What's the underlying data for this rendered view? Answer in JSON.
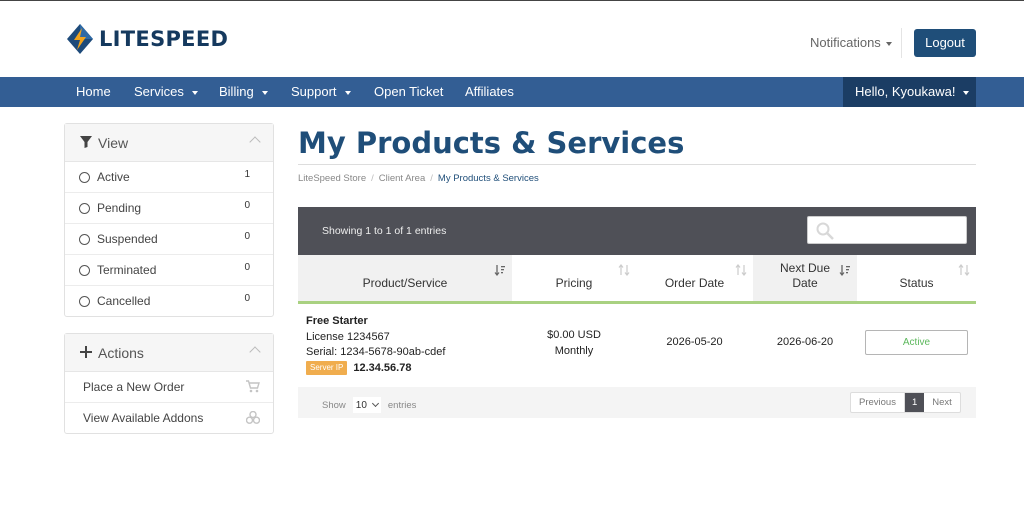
{
  "brand": {
    "name": "LITESPEED"
  },
  "header": {
    "notifications_label": "Notifications",
    "logout_label": "Logout"
  },
  "nav": {
    "items": [
      {
        "label": "Home",
        "has_caret": false
      },
      {
        "label": "Services",
        "has_caret": true
      },
      {
        "label": "Billing",
        "has_caret": true
      },
      {
        "label": "Support",
        "has_caret": true
      },
      {
        "label": "Open Ticket",
        "has_caret": false
      },
      {
        "label": "Affiliates",
        "has_caret": false
      }
    ],
    "user_label": "Hello, Kyoukawa!"
  },
  "sidebar": {
    "view": {
      "title": "View",
      "icon": "filter-icon",
      "filters": [
        {
          "label": "Active",
          "count": "1"
        },
        {
          "label": "Pending",
          "count": "0"
        },
        {
          "label": "Suspended",
          "count": "0"
        },
        {
          "label": "Terminated",
          "count": "0"
        },
        {
          "label": "Cancelled",
          "count": "0"
        }
      ]
    },
    "actions": {
      "title": "Actions",
      "icon": "plus-icon",
      "items": [
        {
          "label": "Place a New Order",
          "icon": "cart-icon"
        },
        {
          "label": "View Available Addons",
          "icon": "cubes-icon"
        }
      ]
    }
  },
  "main": {
    "title": "My Products & Services",
    "breadcrumb": [
      "LiteSpeed Store",
      "Client Area",
      "My Products & Services"
    ],
    "table": {
      "info": "Showing 1 to 1 of 1 entries",
      "search_value": "",
      "columns": [
        {
          "label": "Product/Service",
          "sorted": true
        },
        {
          "label": "Pricing",
          "sorted": false
        },
        {
          "label": "Order Date",
          "sorted": false
        },
        {
          "label": "Next Due Date",
          "sorted": true
        },
        {
          "label": "Status",
          "sorted": false
        }
      ],
      "rows": [
        {
          "product_name": "Free Starter",
          "license": "License 1234567",
          "serial": "Serial: 1234-5678-90ab-cdef",
          "ip_badge": "Server IP",
          "ip": "12.34.56.78",
          "price": "$0.00 USD",
          "cycle": "Monthly",
          "order_date": "2026-05-20",
          "next_due_date": "2026-06-20",
          "status": "Active"
        }
      ],
      "length_label_before": "Show",
      "length_value": "10",
      "length_label_after": "entries",
      "pagination": {
        "previous": "Previous",
        "current": "1",
        "next": "Next"
      }
    }
  },
  "colors": {
    "brand_dark": "#15395e",
    "navbar": "#335e94",
    "navbar_user": "#1b3d64",
    "title": "#1f4e79",
    "table_bar": "#4f5057",
    "column_underline": "#a9d181",
    "status_active": "#5cb85c",
    "badge": "#f0ad4e"
  }
}
